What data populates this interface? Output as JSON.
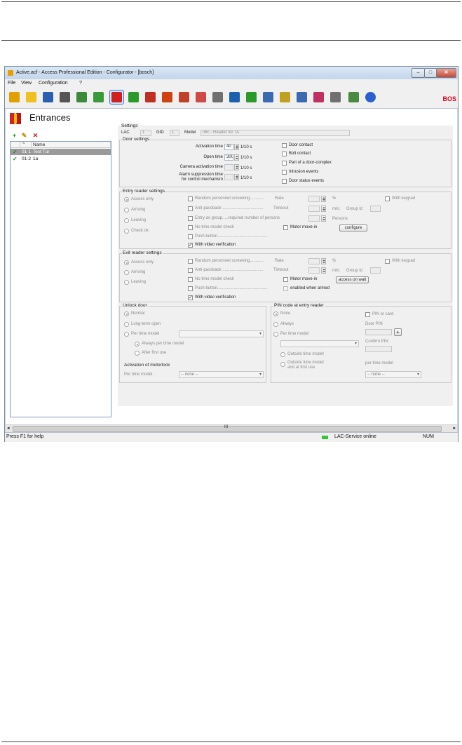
{
  "window": {
    "title": "Active.acf - Access Professional Edition - Configurator - [bosch]",
    "controls": [
      "minimize",
      "maximize",
      "close"
    ]
  },
  "menu": [
    "File",
    "View",
    "Configuration",
    "?"
  ],
  "toolbar": {
    "icons": [
      "new-file-icon",
      "open-folder-icon",
      "save-icon",
      "tools-icon",
      "network-icon",
      "card-reader-icon",
      "entrances-icon",
      "upload-icon",
      "download-icon",
      "alarm-icon",
      "calendar-icon",
      "time-icon",
      "time-model-icon",
      "persons-icon",
      "area-icon",
      "report-icon",
      "log-icon",
      "print-icon",
      "badge-icon",
      "video-icon",
      "map-icon",
      "help-icon"
    ],
    "selected": "entrances-icon",
    "brand": "BOS"
  },
  "page": {
    "title": "Entrances"
  },
  "list": {
    "columns": [
      "Name"
    ],
    "rows": [
      {
        "id": "01-1",
        "name": "Test Tür",
        "selected": true
      },
      {
        "id": "01-2",
        "name": "1a",
        "selected": false
      }
    ]
  },
  "settings": {
    "title": "Settings",
    "lac_label": "LAC",
    "lac_value": "1",
    "gid_label": "GID",
    "gid_value": "1",
    "model_label": "Model",
    "model_value": "06c - Reader for TA"
  },
  "door": {
    "title": "Door settings",
    "activation_label": "Activation time",
    "activation_value": "40",
    "unit1": "1/10 s",
    "open_label": "Open time",
    "open_value": "300",
    "unit2": "1/10 s",
    "camera_label": "Camera activation time",
    "unit3": "1/10 s",
    "alarm_label1": "Alarm suppression time",
    "alarm_label2": "for control mechanism",
    "unit4": "1/10 s",
    "checks": [
      "Door contact",
      "Bolt contact",
      "Part of a door-complex",
      "Intrusion events",
      "Door status events"
    ]
  },
  "entry": {
    "title": "Entry reader settings",
    "radios": [
      "Access only",
      "Arriving",
      "Leaving",
      "Check ok"
    ],
    "random": "Random personnel screening............",
    "rate": "Rate",
    "pct": "%",
    "with_keypad": "With keypad",
    "antipassback": "Anti-passback ...................................",
    "timeout": "Timeout",
    "min": "min.",
    "group_id": "Group id",
    "entry_group": "Entry as group.....required number of persons",
    "persons": "Persons",
    "no_time_model": "No time model check",
    "motor": "Motor move-in",
    "configure": "configure",
    "push_button": "Push button...........................................",
    "video": "With video verification"
  },
  "exit": {
    "title": "Exit reader settings",
    "radios": [
      "Access only",
      "Arriving",
      "Leaving"
    ],
    "random": "Random personnel screening............",
    "rate": "Rate",
    "pct": "%",
    "with_keypad": "With keypad",
    "antipassback": "Anti-passback ...................................",
    "timeout": "Timeout",
    "min": "min.",
    "group_id": "Group id",
    "no_time_model": "No time model check",
    "motor": "Motor move-in",
    "access_on_wait": "access on wait",
    "push_button": "Push button...........................................",
    "enabled_when_armed": "enabled when armed",
    "video": "With video verification"
  },
  "unlock": {
    "title": "Unlock door",
    "normal": "Normal",
    "long_term": "Long-term open",
    "per_time_model": "Per time model",
    "always_per": "Always per time model",
    "after_first": "After first use",
    "motorlock_title": "Activation of motorlock",
    "per_tm_label": "Per time model:",
    "per_tm_value": "-- none --"
  },
  "pin": {
    "title": "PIN code at entry reader",
    "none": "None",
    "always": "Always",
    "per_time_model": "Per time model",
    "outside": "Outside time model",
    "outside_first1": "Outside time model",
    "outside_first2": "and at first use",
    "pin_or_card": "PIN or card",
    "door_pin": "Door PIN",
    "confirm_pin": "Confirm PIN",
    "per_tm_label": "per time model",
    "per_tm_value": "-- none --"
  },
  "scrollbar": {
    "thumb": "III"
  },
  "status": {
    "help": "Press F1 for help",
    "service": "LAC-Service online",
    "num": "NUM"
  },
  "colors": {
    "selection": "#9a9a9a",
    "check_green": "#1a8a1a",
    "brand_red": "#d8001d",
    "online_green": "#32c832"
  }
}
